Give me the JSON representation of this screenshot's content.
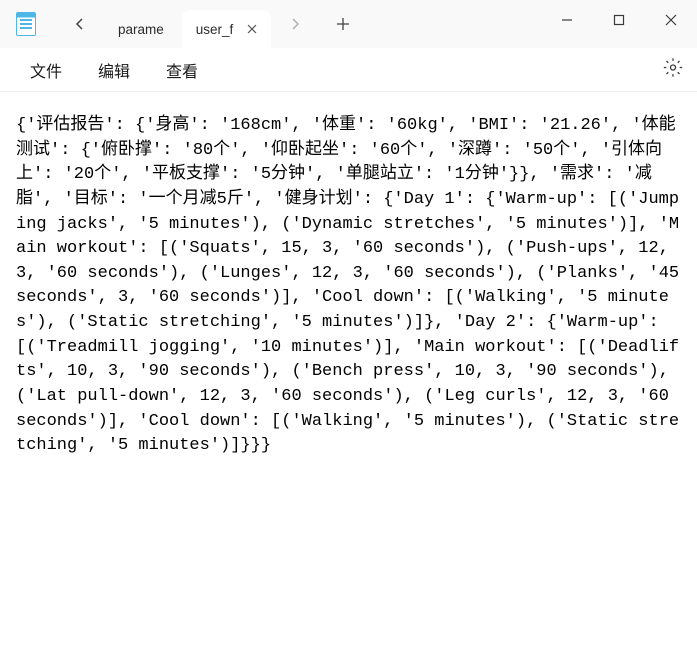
{
  "titlebar": {
    "tabs": [
      {
        "label": "parame",
        "active": false
      },
      {
        "label": "user_f",
        "active": true
      }
    ]
  },
  "menubar": {
    "file": "文件",
    "edit": "编辑",
    "view": "查看"
  },
  "content": "{'评估报告': {'身高': '168cm', '体重': '60kg', 'BMI': '21.26', '体能测试': {'俯卧撑': '80个', '仰卧起坐': '60个', '深蹲': '50个', '引体向上': '20个', '平板支撑': '5分钟', '单腿站立': '1分钟'}}, '需求': '减脂', '目标': '一个月减5斤', '健身计划': {'Day 1': {'Warm-up': [('Jumping jacks', '5 minutes'), ('Dynamic stretches', '5 minutes')], 'Main workout': [('Squats', 15, 3, '60 seconds'), ('Push-ups', 12, 3, '60 seconds'), ('Lunges', 12, 3, '60 seconds'), ('Planks', '45 seconds', 3, '60 seconds')], 'Cool down': [('Walking', '5 minutes'), ('Static stretching', '5 minutes')]}, 'Day 2': {'Warm-up': [('Treadmill jogging', '10 minutes')], 'Main workout': [('Deadlifts', 10, 3, '90 seconds'), ('Bench press', 10, 3, '90 seconds'), ('Lat pull-down', 12, 3, '60 seconds'), ('Leg curls', 12, 3, '60 seconds')], 'Cool down': [('Walking', '5 minutes'), ('Static stretching', '5 minutes')]}}}"
}
